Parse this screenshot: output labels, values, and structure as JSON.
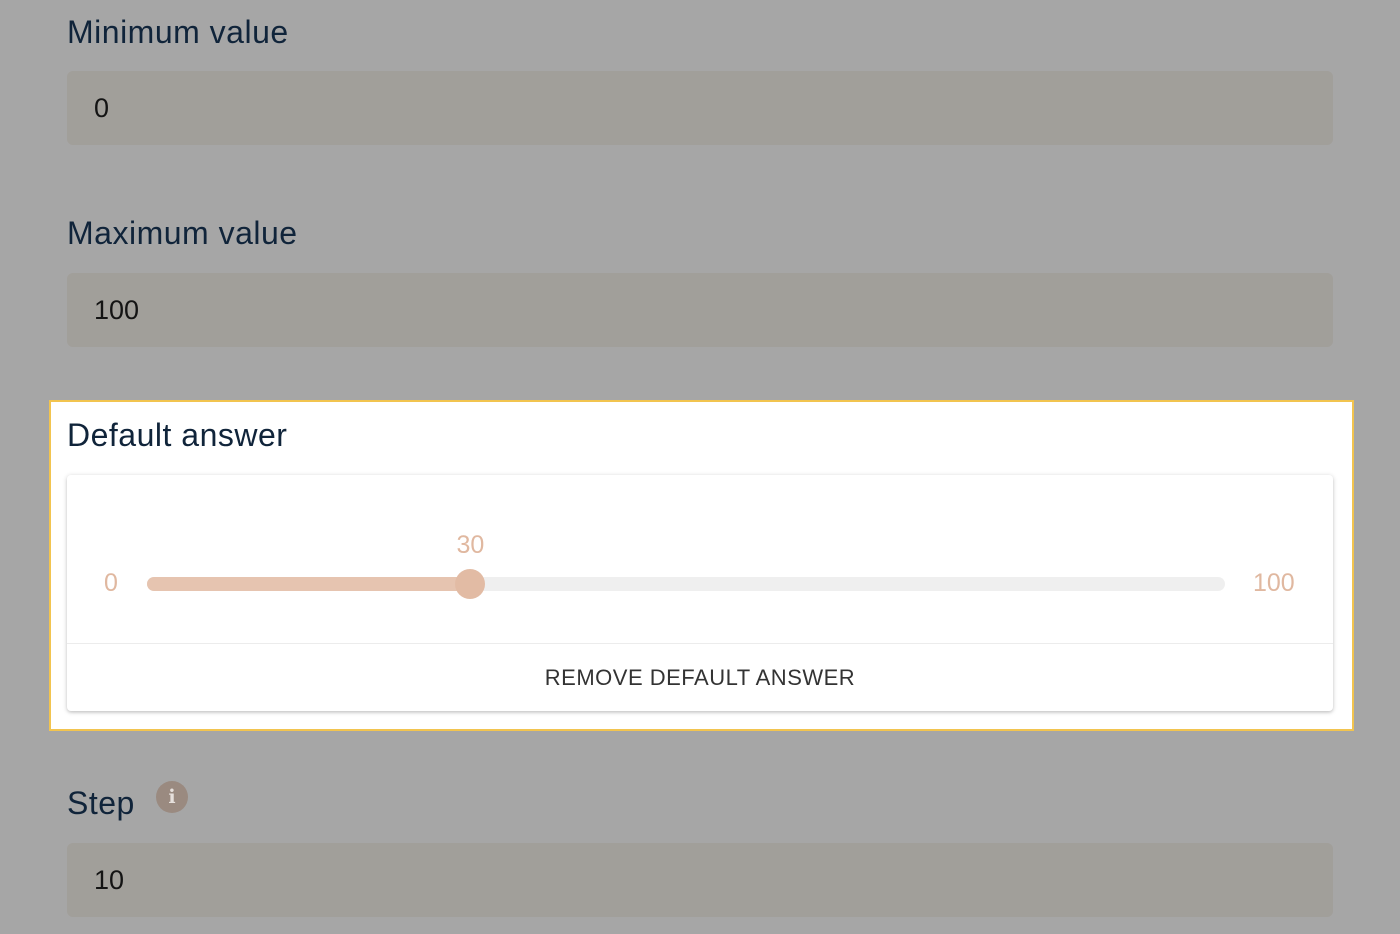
{
  "fields": {
    "minimum": {
      "label": "Minimum value",
      "value": "0"
    },
    "maximum": {
      "label": "Maximum value",
      "value": "100"
    },
    "default": {
      "label": "Default answer",
      "slider": {
        "min_label": "0",
        "max_label": "100",
        "min": 0,
        "max": 100,
        "value": 30,
        "value_label": "30"
      },
      "remove_label": "REMOVE DEFAULT ANSWER"
    },
    "step": {
      "label": "Step",
      "value": "10",
      "info_icon_glyph": "i"
    }
  },
  "colors": {
    "overlay": "#a6a6a6",
    "input_bg": "#a19f9a",
    "highlight_border": "#f2c44f",
    "slider_accent": "#e2bba4",
    "slider_track": "#efefef",
    "label_text": "#10243a"
  },
  "icons": {
    "step_info": "info-icon"
  }
}
